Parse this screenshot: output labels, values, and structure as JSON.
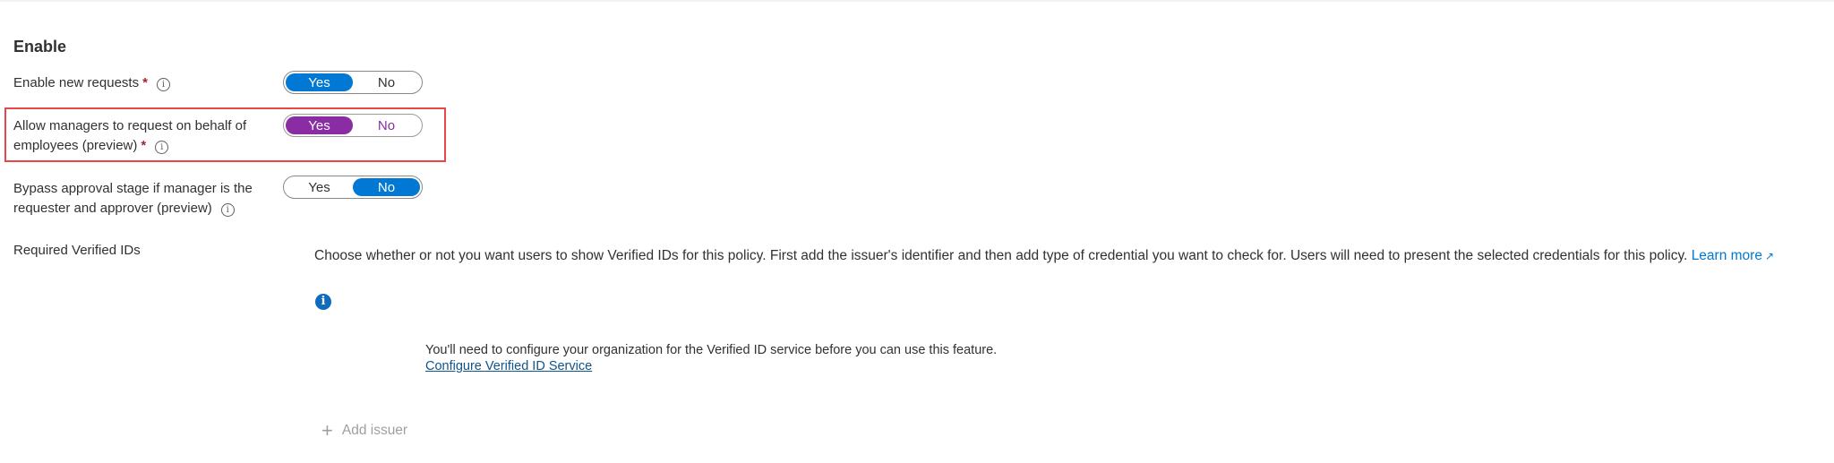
{
  "section": {
    "title": "Enable"
  },
  "rows": [
    {
      "label": "Enable new requests",
      "required": "*",
      "yes": "Yes",
      "no": "No",
      "selected": "Yes"
    },
    {
      "label": "Allow managers to request on behalf of employees (preview)",
      "required": "*",
      "yes": "Yes",
      "no": "No",
      "selected": "Yes"
    },
    {
      "label": "Bypass approval stage if manager is the requester and approver (preview)",
      "yes": "Yes",
      "no": "No",
      "selected": "No"
    }
  ],
  "verified_ids": {
    "label": "Required Verified IDs",
    "description": "Choose whether or not you want users to show Verified IDs for this policy. First add the issuer's identifier and then add type of credential you want to check for. Users will need to present the selected credentials for this policy.",
    "learn_more": "Learn more",
    "notice": "You'll need to configure your organization for the Verified ID service before you can use this feature.",
    "configure_link": "Configure Verified ID Service",
    "add_issuer": "Add issuer"
  },
  "colors": {
    "toggle_on": "#0078d4",
    "toggle_highlight": "#8a2da5",
    "highlight_border": "#e8474a",
    "required": "#a4262c",
    "link": "#0078d4"
  },
  "icons": {
    "info": "info-circle-icon",
    "external_link": "external-link-icon",
    "info_solid": "info-filled-icon",
    "plus": "plus-icon"
  }
}
